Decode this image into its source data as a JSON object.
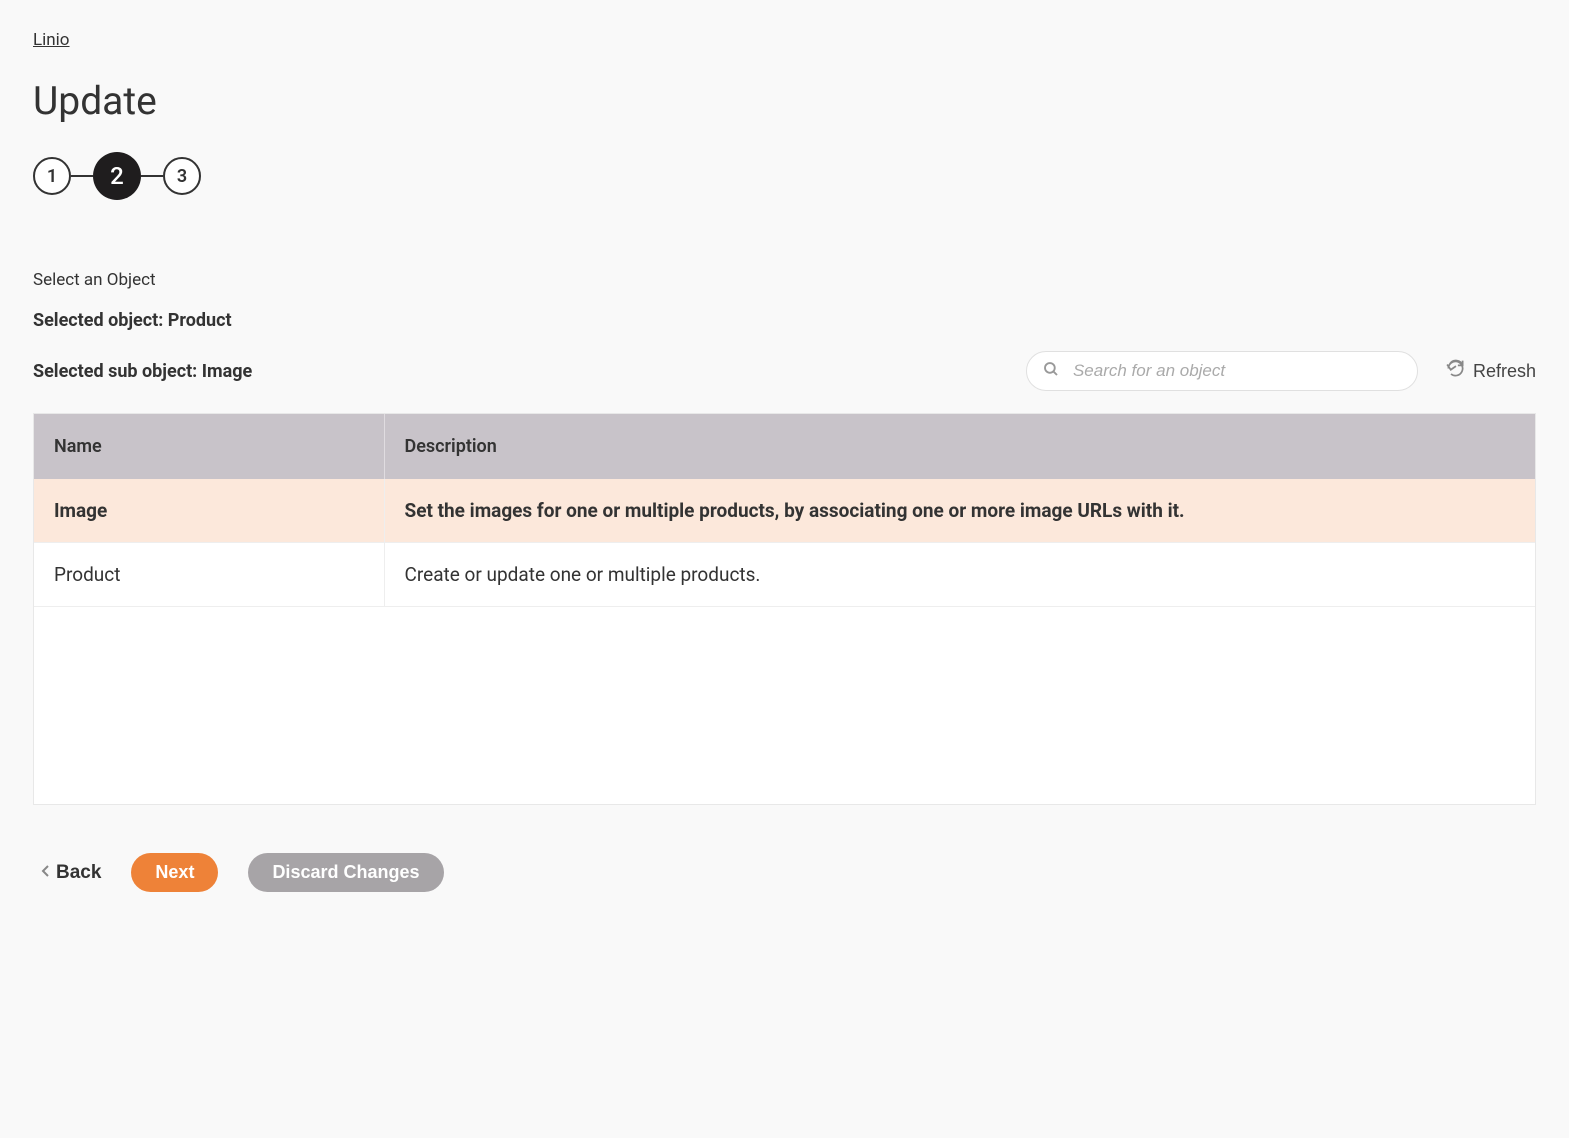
{
  "breadcrumb": {
    "label": "Linio"
  },
  "page": {
    "title": "Update"
  },
  "stepper": {
    "steps": [
      "1",
      "2",
      "3"
    ],
    "active_index": 1
  },
  "section": {
    "label": "Select an Object",
    "selected_object_line": "Selected object: Product",
    "selected_sub_object_line": "Selected sub object: Image"
  },
  "search": {
    "placeholder": "Search for an object"
  },
  "refresh": {
    "label": "Refresh"
  },
  "table": {
    "headers": {
      "name": "Name",
      "description": "Description"
    },
    "rows": [
      {
        "name": "Image",
        "description": "Set the images for one or multiple products, by associating one or more image URLs with it.",
        "selected": true
      },
      {
        "name": "Product",
        "description": "Create or update one or multiple products.",
        "selected": false
      }
    ]
  },
  "footer": {
    "back": "Back",
    "next": "Next",
    "discard": "Discard Changes"
  }
}
